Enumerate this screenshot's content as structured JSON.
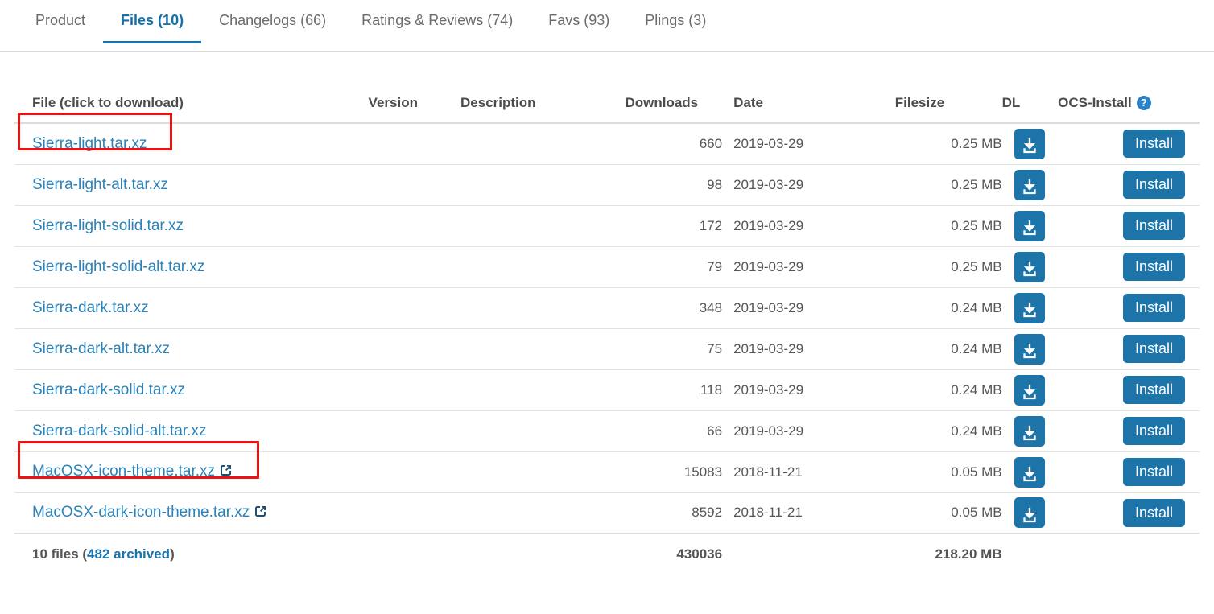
{
  "tabs": [
    {
      "label": "Product",
      "active": false
    },
    {
      "label": "Files (10)",
      "active": true
    },
    {
      "label": "Changelogs (66)",
      "active": false
    },
    {
      "label": "Ratings & Reviews (74)",
      "active": false
    },
    {
      "label": "Favs (93)",
      "active": false
    },
    {
      "label": "Plings (3)",
      "active": false
    }
  ],
  "table": {
    "headers": {
      "file": "File (click to download)",
      "version": "Version",
      "description": "Description",
      "downloads": "Downloads",
      "date": "Date",
      "filesize": "Filesize",
      "dl": "DL",
      "ocs_install": "OCS-Install",
      "ocs_help_icon": "question-mark-icon"
    },
    "install_button_label": "Install",
    "download_icon": "download-tray-icon",
    "external_link_icon": "external-link-icon",
    "rows": [
      {
        "file": "Sierra-light.tar.xz",
        "version": "",
        "description": "",
        "downloads": "660",
        "date": "2019-03-29",
        "filesize": "0.25 MB",
        "external": false,
        "highlighted": true
      },
      {
        "file": "Sierra-light-alt.tar.xz",
        "version": "",
        "description": "",
        "downloads": "98",
        "date": "2019-03-29",
        "filesize": "0.25 MB",
        "external": false,
        "highlighted": false
      },
      {
        "file": "Sierra-light-solid.tar.xz",
        "version": "",
        "description": "",
        "downloads": "172",
        "date": "2019-03-29",
        "filesize": "0.25 MB",
        "external": false,
        "highlighted": false
      },
      {
        "file": "Sierra-light-solid-alt.tar.xz",
        "version": "",
        "description": "",
        "downloads": "79",
        "date": "2019-03-29",
        "filesize": "0.25 MB",
        "external": false,
        "highlighted": false
      },
      {
        "file": "Sierra-dark.tar.xz",
        "version": "",
        "description": "",
        "downloads": "348",
        "date": "2019-03-29",
        "filesize": "0.24 MB",
        "external": false,
        "highlighted": false
      },
      {
        "file": "Sierra-dark-alt.tar.xz",
        "version": "",
        "description": "",
        "downloads": "75",
        "date": "2019-03-29",
        "filesize": "0.24 MB",
        "external": false,
        "highlighted": false
      },
      {
        "file": "Sierra-dark-solid.tar.xz",
        "version": "",
        "description": "",
        "downloads": "118",
        "date": "2019-03-29",
        "filesize": "0.24 MB",
        "external": false,
        "highlighted": false
      },
      {
        "file": "Sierra-dark-solid-alt.tar.xz",
        "version": "",
        "description": "",
        "downloads": "66",
        "date": "2019-03-29",
        "filesize": "0.24 MB",
        "external": false,
        "highlighted": false
      },
      {
        "file": "MacOSX-icon-theme.tar.xz",
        "version": "",
        "description": "",
        "downloads": "15083",
        "date": "2018-11-21",
        "filesize": "0.05 MB",
        "external": true,
        "highlighted": true
      },
      {
        "file": "MacOSX-dark-icon-theme.tar.xz",
        "version": "",
        "description": "",
        "downloads": "8592",
        "date": "2018-11-21",
        "filesize": "0.05 MB",
        "external": true,
        "highlighted": false
      }
    ],
    "footer": {
      "files_prefix": "10 files (",
      "archived_label": "482 archived",
      "files_suffix": ")",
      "total_downloads": "430036",
      "total_filesize": "218.20 MB"
    }
  },
  "colors": {
    "link_blue": "#2b82b8",
    "accent_blue": "#1c74a8",
    "highlight_red": "#ee1111",
    "header_text": "#4c4c4c"
  }
}
